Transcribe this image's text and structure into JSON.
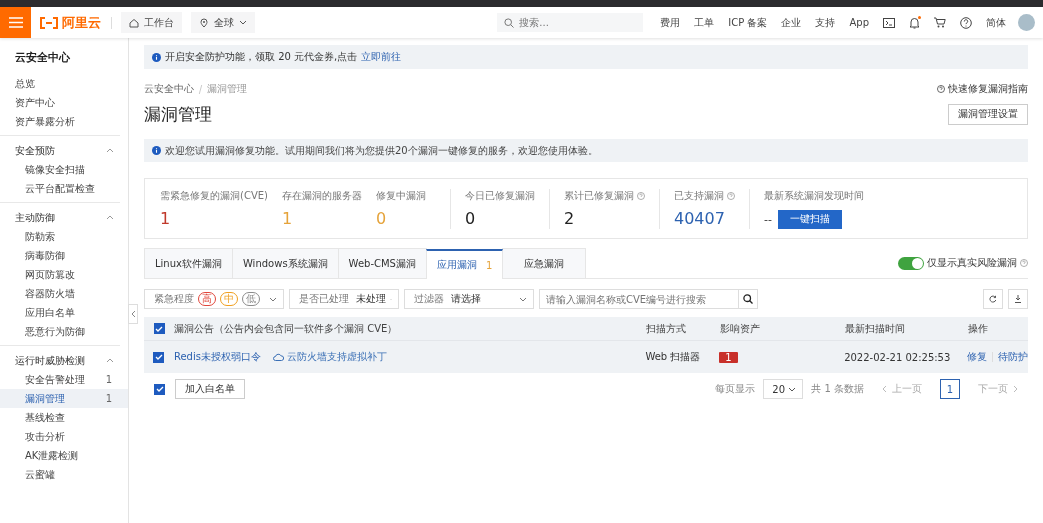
{
  "header": {
    "logo": "阿里云",
    "workbench": "工作台",
    "region": "全球",
    "search_placeholder": "搜索...",
    "links": [
      "费用",
      "工单",
      "ICP 备案",
      "企业",
      "支持",
      "App"
    ],
    "notification_dot": true,
    "language": "简体"
  },
  "sidebar": {
    "title": "云安全中心",
    "groups": [
      {
        "items": [
          {
            "label": "总览",
            "selected": false
          },
          {
            "label": "资产中心",
            "selected": false
          },
          {
            "label": "资产暴露分析",
            "selected": false
          }
        ]
      },
      {
        "label": "安全预防",
        "expanded": true,
        "items": [
          {
            "label": "镜像安全扫描",
            "selected": false
          },
          {
            "label": "云平台配置检查",
            "selected": false
          }
        ]
      },
      {
        "label": "主动防御",
        "expanded": true,
        "items": [
          {
            "label": "防勒索",
            "selected": false
          },
          {
            "label": "病毒防御",
            "selected": false
          },
          {
            "label": "网页防篡改",
            "selected": false
          },
          {
            "label": "容器防火墙",
            "selected": false
          },
          {
            "label": "应用白名单",
            "selected": false
          },
          {
            "label": "恶意行为防御",
            "selected": false
          }
        ]
      },
      {
        "label": "运行时威胁检测",
        "expanded": true,
        "items": [
          {
            "label": "安全告警处理",
            "badge": "1",
            "selected": false
          },
          {
            "label": "漏洞管理",
            "badge": "1",
            "selected": true
          },
          {
            "label": "基线检查",
            "selected": false
          },
          {
            "label": "攻击分析",
            "selected": false
          },
          {
            "label": "AK泄露检测",
            "selected": false
          },
          {
            "label": "云蜜罐",
            "selected": false
          }
        ]
      }
    ]
  },
  "notice": {
    "text": "开启安全防护功能，领取 20 元代金券,点击",
    "link": "立即前往"
  },
  "breadcrumb": [
    "云安全中心",
    "漏洞管理"
  ],
  "guide_link": "快速修复漏洞指南",
  "title": "漏洞管理",
  "settings_button": "漏洞管理设置",
  "info": "欢迎您试用漏洞修复功能。试用期间我们将为您提供20个漏洞一键修复的服务，欢迎您使用体验。",
  "stat_groups": [
    {
      "items": [
        {
          "label": "需紧急修复的漏洞(CVE)",
          "value": "1",
          "color": "#c0392b",
          "help": false
        },
        {
          "label": "存在漏洞的服务器",
          "value": "1",
          "color": "#e5a33a",
          "help": false
        },
        {
          "label": "修复中漏洞",
          "value": "0",
          "color": "#e5a33a",
          "help": false
        }
      ]
    },
    {
      "items": [
        {
          "label": "今日已修复漏洞",
          "value": "0",
          "color": "#222222",
          "help": false
        }
      ]
    },
    {
      "items": [
        {
          "label": "累计已修复漏洞",
          "value": "2",
          "color": "#222222",
          "help": true
        }
      ]
    },
    {
      "items": [
        {
          "label": "已支持漏洞",
          "value": "40407",
          "color": "#2d62b0",
          "help": true
        }
      ]
    }
  ],
  "scan": {
    "label": "最新系统漏洞发现时间",
    "value": "--",
    "button": "一键扫描"
  },
  "tabs": [
    {
      "label": "Linux软件漏洞",
      "selected": false
    },
    {
      "label": "Windows系统漏洞",
      "selected": false
    },
    {
      "label": "Web-CMS漏洞",
      "selected": false
    },
    {
      "label": "应用漏洞",
      "count": "1",
      "selected": true
    },
    {
      "label": "应急漏洞",
      "selected": false
    }
  ],
  "toggle": {
    "label": "仅显示真实风险漏洞",
    "on": true
  },
  "filters": {
    "severity": {
      "label": "紧急程度",
      "levels": [
        {
          "label": "高",
          "color": "#e0463b"
        },
        {
          "label": "中",
          "color": "#f0a020"
        },
        {
          "label": "低",
          "color": "#8c8c8c"
        }
      ]
    },
    "processed": {
      "label": "是否已处理",
      "value": "未处理"
    },
    "filter": {
      "label": "过滤器",
      "placeholder": "请选择"
    },
    "search_placeholder": "请输入漏洞名称或CVE编号进行搜索"
  },
  "table": {
    "header_checked": true,
    "columns": [
      "漏洞公告（公告内会包含同一软件多个漏洞 CVE）",
      "扫描方式",
      "影响资产",
      "最新扫描时间",
      "操作"
    ],
    "rows": [
      {
        "checked": true,
        "name": "Redis未授权弱口令",
        "tag": "云防火墙支持虚拟补丁",
        "scan": "Web 扫描器",
        "assets": "1",
        "time": "2022-02-21 02:25:53",
        "actions": [
          "修复",
          "待防护"
        ]
      }
    ]
  },
  "footer": {
    "checked": true,
    "whitelist_button": "加入白名单",
    "page_size_label": "每页显示",
    "page_size": "20",
    "total": "共 1 条数据",
    "prev": "上一页",
    "pages": [
      {
        "label": "1",
        "selected": true
      }
    ],
    "next": "下一页"
  }
}
